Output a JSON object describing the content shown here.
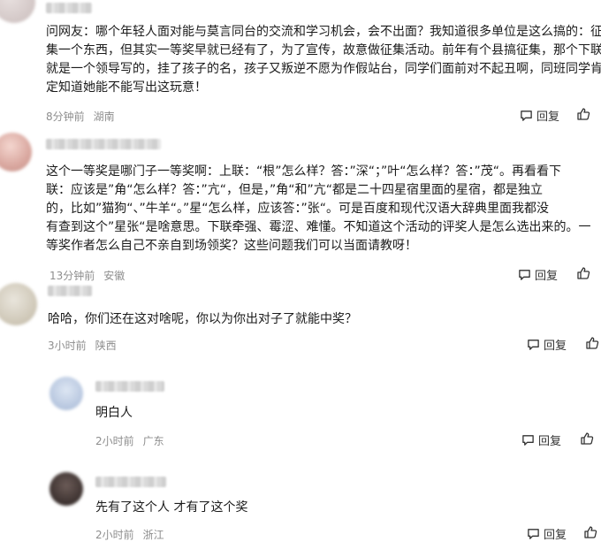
{
  "comments": [
    {
      "lines": [
        "问网友：哪个年轻人面对能与莫言同台的交流和学习机会，会不出面？我知道很多单位是这么搞的：征",
        "集一个东西，但其实一等奖早就已经有了，为了宣传，故意做征集活动。前年有个县搞征集，那个下联",
        "就是一个领导写的，挂了孩子的名，孩子又叛逆不愿为作假站台，同学们面前对不起丑啊，同班同学肯",
        "定知道她能不能写出这玩意！"
      ],
      "time": "8分钟前",
      "location": "湖南",
      "reply_label": "回复"
    },
    {
      "lines": [
        "这个一等奖是哪门子一等奖啊：上联：“根”怎么样？答：”深“；”叶“怎么样？答：”茂“。再看看下",
        "联：应该是”角“怎么样？答：”亢“，但是，”角“和”亢“都是二十四星宿里面的星宿，都是独立",
        "的，比如”猫狗“、”牛羊“。”星“怎么样，应该答：”张“。可是百度和现代汉语大辞典里面我都没",
        "有查到这个”星张“是啥意思。下联牵强、霉涩、难懂。不知道这个活动的评奖人是怎么选出来的。一",
        "等奖作者怎么自己不亲自到场领奖？这些问题我们可以当面请教呀！"
      ],
      "time": "13分钟前",
      "location": "安徽",
      "reply_label": "回复"
    },
    {
      "lines": [
        "哈哈，你们还在这对啥呢，你以为你出对子了就能中奖？"
      ],
      "time": "3小时前",
      "location": "陕西",
      "reply_label": "回复"
    },
    {
      "lines": [
        "明白人"
      ],
      "time": "2小时前",
      "location": "广东",
      "reply_label": "回复"
    },
    {
      "lines": [
        "先有了这个人 才有了这个奖"
      ],
      "time": "2小时前",
      "location": "浙江",
      "reply_label": "回复"
    }
  ],
  "icons": [
    "reply-icon",
    "like-icon"
  ]
}
